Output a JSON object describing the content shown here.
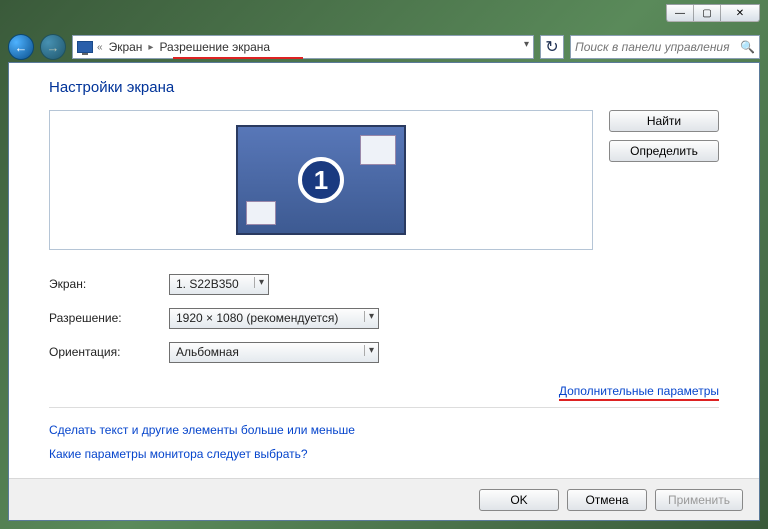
{
  "breadcrumb": {
    "prefix": "«",
    "item1": "Экран",
    "item2": "Разрешение экрана"
  },
  "search": {
    "placeholder": "Поиск в панели управления"
  },
  "heading": "Настройки экрана",
  "monitor_number": "1",
  "buttons": {
    "detect": "Найти",
    "identify": "Определить"
  },
  "labels": {
    "display": "Экран:",
    "resolution": "Разрешение:",
    "orientation": "Ориентация:"
  },
  "values": {
    "display": "1. S22B350",
    "resolution": "1920 × 1080 (рекомендуется)",
    "orientation": "Альбомная"
  },
  "links": {
    "advanced": "Дополнительные параметры",
    "text_size": "Сделать текст и другие элементы больше или меньше",
    "which_monitor": "Какие параметры монитора следует выбрать?"
  },
  "footer": {
    "ok": "OK",
    "cancel": "Отмена",
    "apply": "Применить"
  }
}
